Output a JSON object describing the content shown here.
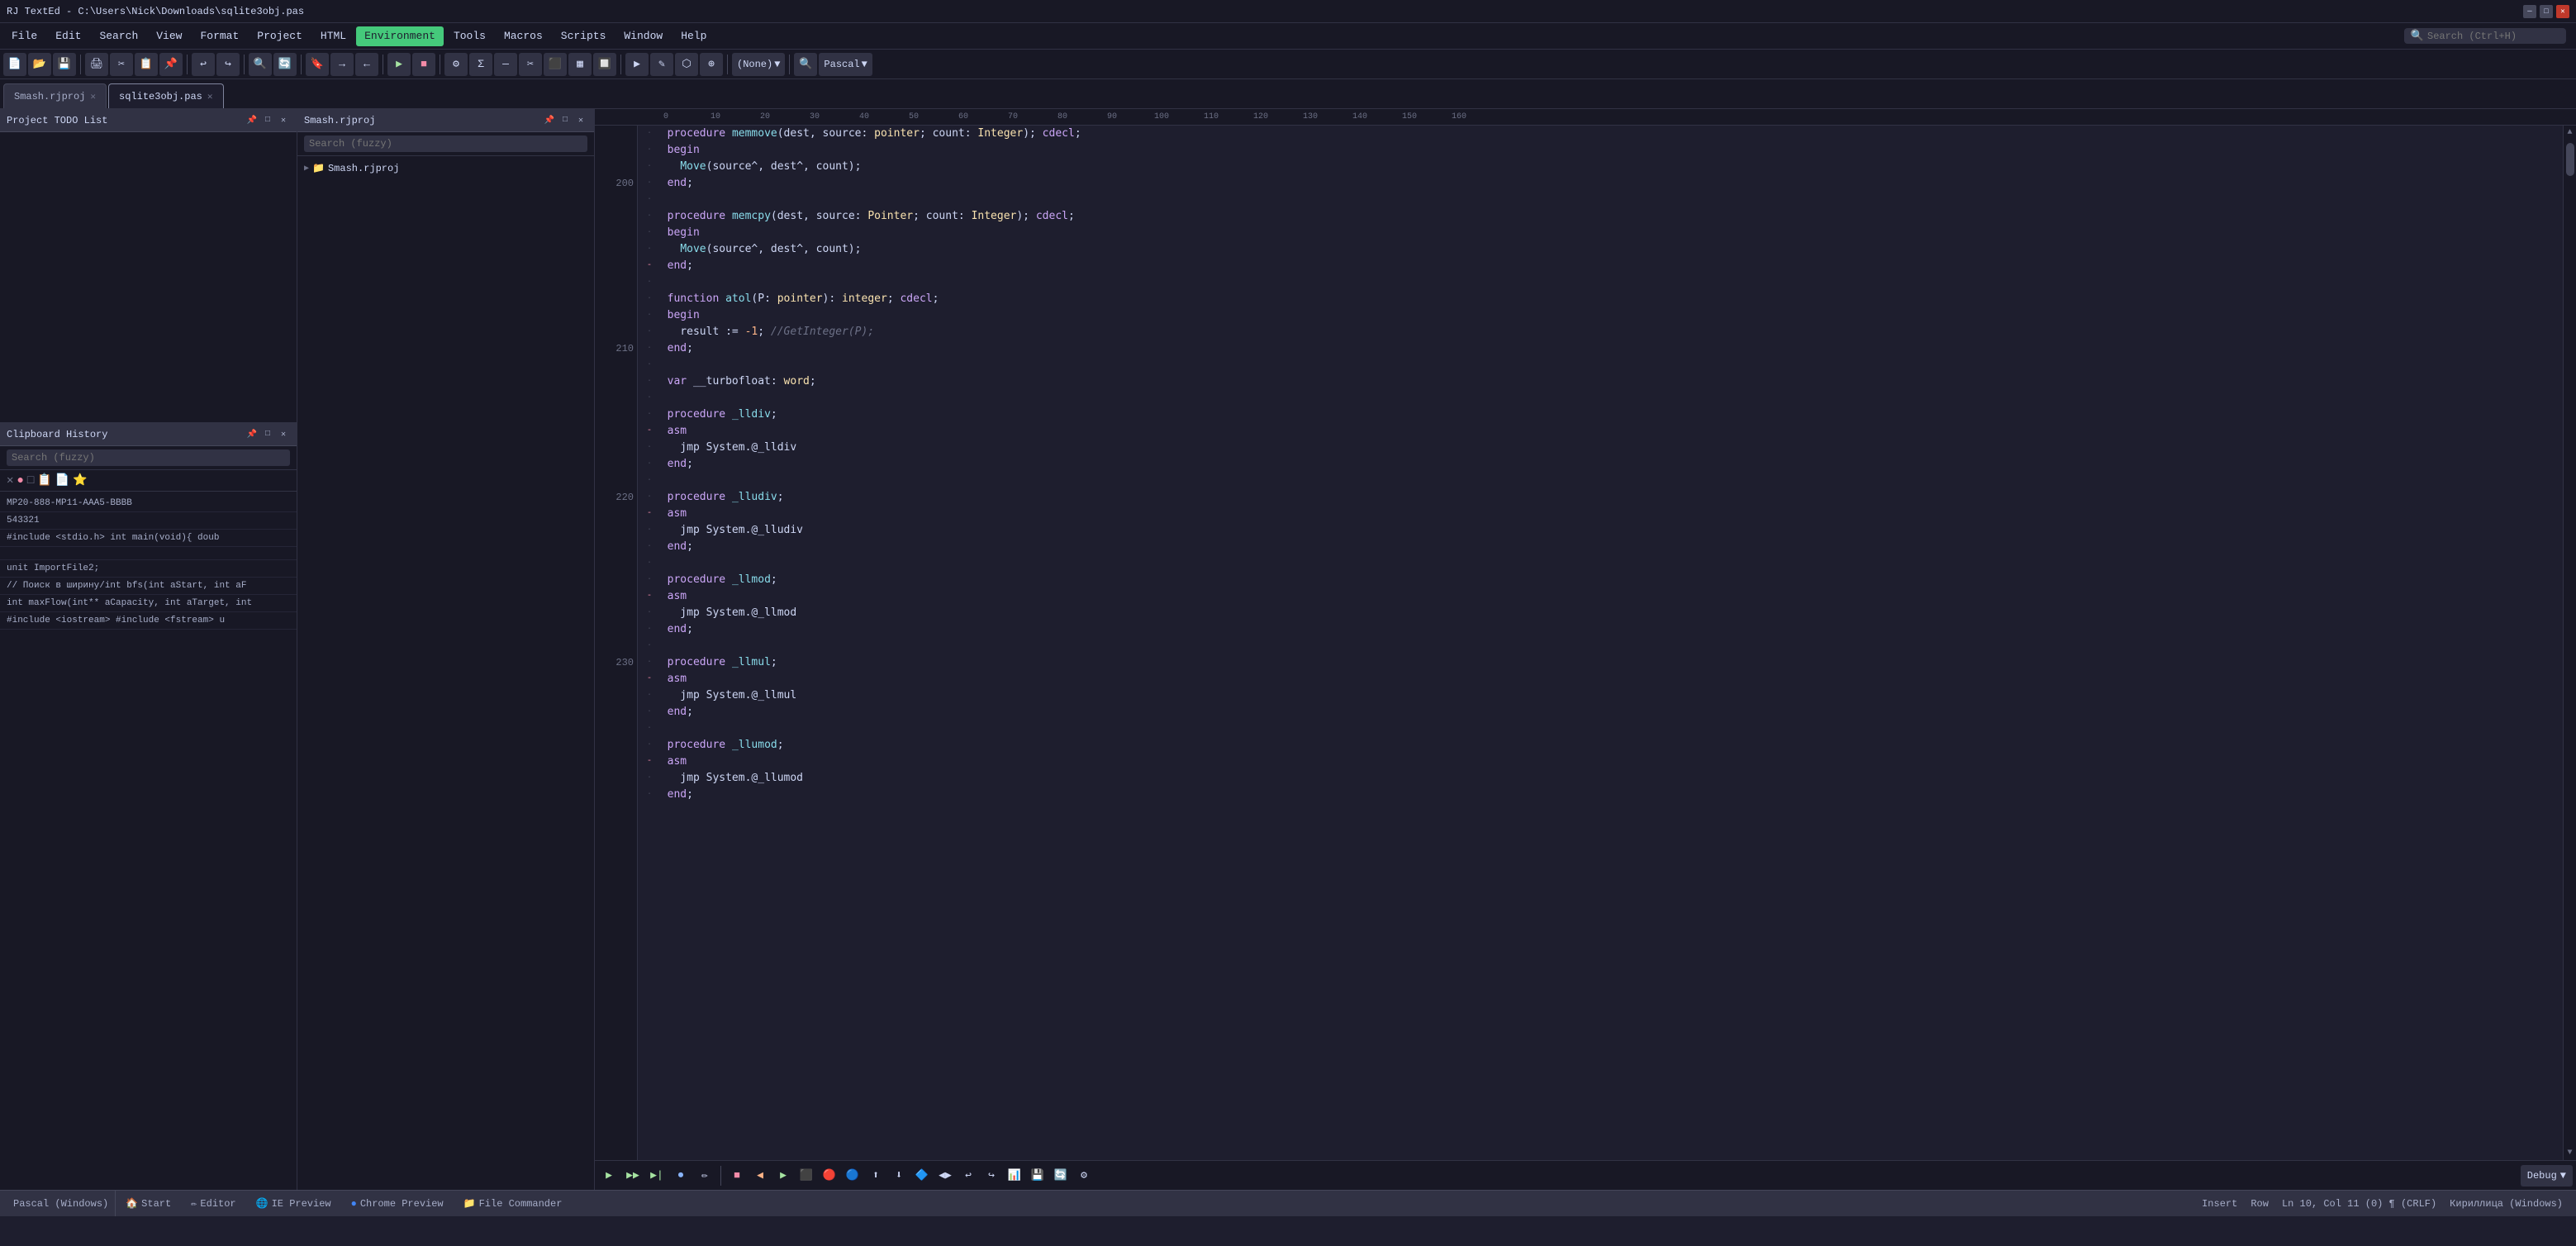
{
  "titlebar": {
    "title": "RJ TextEd - C:\\Users\\Nick\\Downloads\\sqlite3obj.pas",
    "win_controls": [
      "─",
      "□",
      "✕"
    ]
  },
  "menubar": {
    "items": [
      {
        "label": "File",
        "active": false
      },
      {
        "label": "Edit",
        "active": false
      },
      {
        "label": "Search",
        "active": false
      },
      {
        "label": "View",
        "active": false
      },
      {
        "label": "Format",
        "active": false
      },
      {
        "label": "Project",
        "active": false
      },
      {
        "label": "HTML",
        "active": false
      },
      {
        "label": "Environment",
        "active": true
      },
      {
        "label": "Tools",
        "active": false
      },
      {
        "label": "Macros",
        "active": false
      },
      {
        "label": "Scripts",
        "active": false
      },
      {
        "label": "Window",
        "active": false
      },
      {
        "label": "Help",
        "active": false
      }
    ],
    "search_placeholder": "Search (Ctrl+H)"
  },
  "panels": {
    "project_todo": {
      "title": "Project TODO List",
      "controls": [
        "□",
        "✕"
      ]
    },
    "clipboard_history": {
      "title": "Clipboard History",
      "controls": [
        "□",
        "✕"
      ],
      "search_placeholder": "Search (fuzzy)",
      "items": [
        "MP20-888-MP11-AAA5-BBBB",
        "543321",
        "#include <stdio.h> int main(void){  doub",
        "",
        "unit ImportFile2;",
        "// Поиск в ширину/int bfs(int aStart, int aF",
        "int maxFlow(int** aCapacity, int aTarget, int",
        "#include <iostream> #include <fstream> u"
      ],
      "icon_buttons": [
        "✕",
        "●",
        "□",
        "📋",
        "📁",
        "⭐"
      ]
    },
    "project_tree": {
      "title": "Smash.rjproj",
      "controls": [
        "□",
        "✕"
      ],
      "search_placeholder": "Search (fuzzy)",
      "tree_items": [
        {
          "label": "Smash.rjproj",
          "icon": "📁",
          "arrow": "▶"
        }
      ]
    }
  },
  "tabs": [
    {
      "label": "Smash.rjproj",
      "active": false,
      "closable": true
    },
    {
      "label": "sqlite3obj.pas",
      "active": true,
      "closable": true
    }
  ],
  "ruler": {
    "marks": [
      "0",
      "10",
      "20",
      "30",
      "40",
      "50",
      "60",
      "70",
      "80",
      "90",
      "100",
      "110",
      "120",
      "130",
      "140",
      "150",
      "160"
    ]
  },
  "code": {
    "lines": [
      {
        "num": "",
        "dot": "·",
        "minus": false,
        "text": "  procedure memmove(dest, source: pointer; count: Integer); cdecl;"
      },
      {
        "num": "",
        "dot": "·",
        "minus": false,
        "text": "  begin"
      },
      {
        "num": "",
        "dot": "·",
        "minus": false,
        "text": "    Move(source^, dest^, count);"
      },
      {
        "num": "200",
        "dot": "·",
        "minus": false,
        "text": "  end;"
      },
      {
        "num": "",
        "dot": "·",
        "minus": false,
        "text": ""
      },
      {
        "num": "",
        "dot": "·",
        "minus": false,
        "text": "  procedure memcpy(dest, source: Pointer; count: Integer); cdecl;"
      },
      {
        "num": "",
        "dot": "·",
        "minus": false,
        "text": "  begin"
      },
      {
        "num": "",
        "dot": "·",
        "minus": false,
        "text": "    Move(source^, dest^, count);"
      },
      {
        "num": "",
        "dot": "-",
        "minus": true,
        "text": "  end;"
      },
      {
        "num": "",
        "dot": "·",
        "minus": false,
        "text": ""
      },
      {
        "num": "",
        "dot": "·",
        "minus": false,
        "text": "  function atol(P: pointer): integer; cdecl;"
      },
      {
        "num": "",
        "dot": "·",
        "minus": false,
        "text": "  begin"
      },
      {
        "num": "",
        "dot": "·",
        "minus": false,
        "text": "    result := -1; //GetInteger(P);"
      },
      {
        "num": "210",
        "dot": "·",
        "minus": false,
        "text": "  end;"
      },
      {
        "num": "",
        "dot": "·",
        "minus": false,
        "text": ""
      },
      {
        "num": "",
        "dot": "·",
        "minus": false,
        "text": "  var __turbofloat: word;"
      },
      {
        "num": "",
        "dot": "·",
        "minus": false,
        "text": ""
      },
      {
        "num": "",
        "dot": "·",
        "minus": false,
        "text": "  procedure _lldiv;"
      },
      {
        "num": "",
        "dot": "-",
        "minus": true,
        "text": "  asm"
      },
      {
        "num": "",
        "dot": "·",
        "minus": false,
        "text": "    jmp System.@_lldiv"
      },
      {
        "num": "",
        "dot": "·",
        "minus": false,
        "text": "  end;"
      },
      {
        "num": "",
        "dot": "·",
        "minus": false,
        "text": ""
      },
      {
        "num": "220",
        "dot": "·",
        "minus": false,
        "text": "  procedure _lludiv;"
      },
      {
        "num": "",
        "dot": "-",
        "minus": true,
        "text": "  asm"
      },
      {
        "num": "",
        "dot": "·",
        "minus": false,
        "text": "    jmp System.@_lludiv"
      },
      {
        "num": "",
        "dot": "·",
        "minus": false,
        "text": "  end;"
      },
      {
        "num": "",
        "dot": "·",
        "minus": false,
        "text": ""
      },
      {
        "num": "",
        "dot": "·",
        "minus": false,
        "text": "  procedure _llmod;"
      },
      {
        "num": "",
        "dot": "-",
        "minus": true,
        "text": "  asm"
      },
      {
        "num": "",
        "dot": "·",
        "minus": false,
        "text": "    jmp System.@_llmod"
      },
      {
        "num": "",
        "dot": "·",
        "minus": false,
        "text": "  end;"
      },
      {
        "num": "",
        "dot": "·",
        "minus": false,
        "text": ""
      },
      {
        "num": "230",
        "dot": "·",
        "minus": false,
        "text": "  procedure _llmul;"
      },
      {
        "num": "",
        "dot": "-",
        "minus": true,
        "text": "  asm"
      },
      {
        "num": "",
        "dot": "·",
        "minus": false,
        "text": "    jmp System.@_llmul"
      },
      {
        "num": "",
        "dot": "·",
        "minus": false,
        "text": "  end;"
      },
      {
        "num": "",
        "dot": "·",
        "minus": false,
        "text": ""
      },
      {
        "num": "",
        "dot": "·",
        "minus": false,
        "text": "  procedure _llumod;"
      },
      {
        "num": "",
        "dot": "-",
        "minus": true,
        "text": "  asm"
      },
      {
        "num": "",
        "dot": "·",
        "minus": false,
        "text": "    jmp System.@_llumod"
      },
      {
        "num": "",
        "dot": "·",
        "minus": false,
        "text": "  end;"
      }
    ]
  },
  "debug_toolbar": {
    "dropdown_label": "Debug",
    "buttons": [
      "▶",
      "▶▶",
      "▶|",
      "⏺",
      "✏",
      "🔴",
      "🔵",
      "⚡",
      "📍",
      "🔷",
      "◀",
      "▶",
      "⏸",
      "⏹",
      "↩",
      "↪",
      "⬆",
      "⬇",
      "🔍",
      "💾",
      "🔄",
      "⚙"
    ]
  },
  "status_bar": {
    "left_label": "Pascal (Windows)",
    "tabs": [
      {
        "icon": "🏠",
        "label": "Start"
      },
      {
        "icon": "✏",
        "label": "Editor"
      },
      {
        "icon": "🌐",
        "label": "IE Preview"
      },
      {
        "icon": "🔵",
        "label": "Chrome Preview"
      },
      {
        "icon": "📁",
        "label": "File Commander"
      }
    ],
    "right": {
      "insert": "Insert",
      "row": "Row",
      "position": "Ln 10, Col 11 (0) ¶ (CRLF)",
      "encoding": "Кириллица (Windows)"
    }
  }
}
